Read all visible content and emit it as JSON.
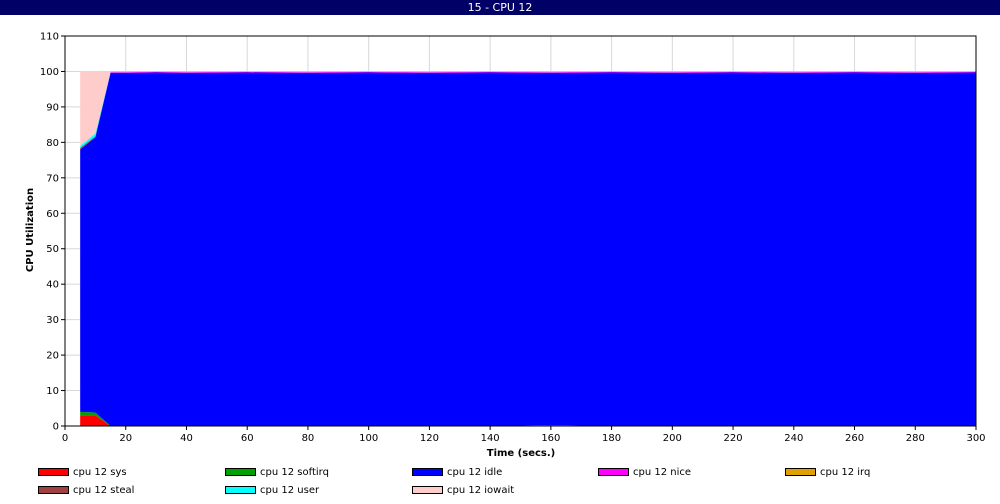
{
  "window": {
    "title": "15 - CPU 12"
  },
  "chart_data": {
    "type": "area",
    "stacked": true,
    "title": "15 - CPU 12",
    "xlabel": "Time (secs.)",
    "ylabel": "CPU Utilization",
    "xlim": [
      0,
      300
    ],
    "ylim": [
      0,
      110
    ],
    "xticks": [
      0,
      20,
      40,
      60,
      80,
      100,
      120,
      140,
      160,
      180,
      200,
      220,
      240,
      260,
      280,
      300
    ],
    "yticks": [
      0,
      10,
      20,
      30,
      40,
      50,
      60,
      70,
      80,
      90,
      100,
      110
    ],
    "grid": true,
    "legend_position": "bottom",
    "x": [
      5,
      10,
      15,
      20,
      30,
      40,
      60,
      80,
      100,
      120,
      140,
      160,
      180,
      200,
      220,
      240,
      260,
      280,
      300
    ],
    "series": [
      {
        "name": "cpu 12 sys",
        "color": "#ff0000",
        "values": [
          3,
          3,
          0,
          0,
          0,
          0,
          0,
          0,
          0,
          0,
          0,
          0,
          0,
          0,
          0,
          0,
          0,
          0,
          0
        ]
      },
      {
        "name": "cpu 12 softirq",
        "color": "#00a000",
        "values": [
          1,
          0.8,
          0,
          0,
          0,
          0,
          0,
          0,
          0,
          0,
          0,
          0.3,
          0,
          0,
          0,
          0,
          0,
          0,
          0
        ]
      },
      {
        "name": "cpu 12 idle",
        "color": "#0000ff",
        "values": [
          74,
          77.6,
          99.6,
          99.6,
          99.7,
          99.6,
          99.7,
          99.6,
          99.7,
          99.6,
          99.7,
          99.3,
          99.7,
          99.6,
          99.7,
          99.6,
          99.7,
          99.6,
          99.7
        ]
      },
      {
        "name": "cpu 12 nice",
        "color": "#ff00ff",
        "values": [
          0,
          0,
          0.2,
          0.2,
          0.2,
          0.2,
          0.2,
          0.2,
          0.2,
          0.2,
          0.2,
          0.2,
          0.2,
          0.2,
          0.2,
          0.2,
          0.2,
          0.2,
          0.2
        ]
      },
      {
        "name": "cpu 12 irq",
        "color": "#e0a000",
        "values": [
          0,
          0,
          0,
          0,
          0,
          0,
          0,
          0,
          0,
          0,
          0,
          0,
          0,
          0,
          0,
          0,
          0,
          0,
          0
        ]
      },
      {
        "name": "cpu 12 steal",
        "color": "#a04040",
        "values": [
          0.4,
          0.3,
          0,
          0,
          0,
          0,
          0,
          0,
          0,
          0,
          0,
          0,
          0,
          0,
          0,
          0,
          0,
          0,
          0
        ]
      },
      {
        "name": "cpu 12 user",
        "color": "#00ffff",
        "values": [
          0.6,
          0.8,
          0.2,
          0.2,
          0.1,
          0.2,
          0.1,
          0.2,
          0.1,
          0.2,
          0.1,
          0.2,
          0.1,
          0.2,
          0.1,
          0.2,
          0.1,
          0.2,
          0.1
        ]
      },
      {
        "name": "cpu 12 iowait",
        "color": "#ffcccc",
        "values": [
          21,
          17.5,
          0,
          0,
          0,
          0,
          0,
          0,
          0,
          0,
          0,
          0,
          0,
          0,
          0,
          0,
          0,
          0,
          0
        ]
      }
    ]
  }
}
